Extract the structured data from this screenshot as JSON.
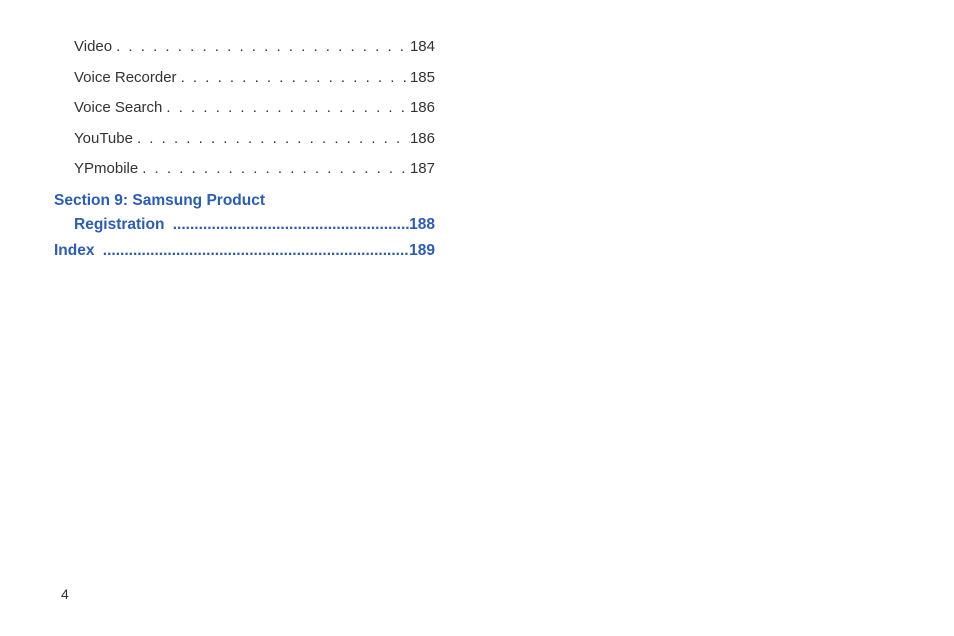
{
  "toc": {
    "entries": [
      {
        "label": "Video",
        "page": "184"
      },
      {
        "label": "Voice Recorder",
        "page": "185"
      },
      {
        "label": "Voice Search",
        "page": "186"
      },
      {
        "label": "YouTube",
        "page": "186"
      },
      {
        "label": "YPmobile",
        "page": "187"
      }
    ],
    "section": {
      "line1": "Section 9:  Samsung Product",
      "line2_label": "Registration",
      "line2_page": "188"
    },
    "index": {
      "label": "Index",
      "page": "189"
    }
  },
  "dots_regular": ". . . . . . . . . . . . . . . . . . . . . . . . . . . . . . . . . . . . . . . . . . . . .",
  "dots_bold": "..........................................................................",
  "page_number": "4"
}
